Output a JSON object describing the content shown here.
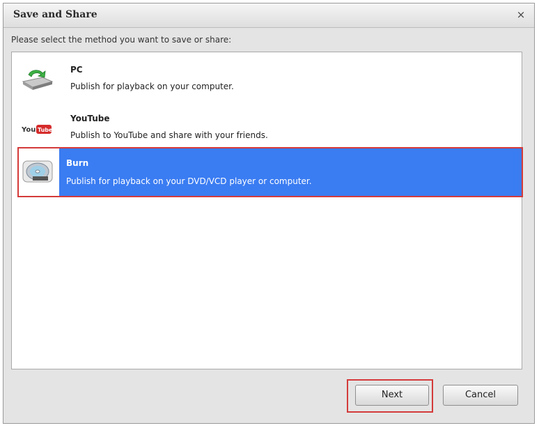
{
  "dialog": {
    "title": "Save and Share",
    "close_symbol": "×",
    "prompt": "Please select the method you want to save or share:"
  },
  "options": [
    {
      "name": "PC",
      "description": "Publish for playback on your computer.",
      "icon": "pc-drive-icon",
      "selected": false
    },
    {
      "name": "YouTube",
      "description": "Publish to YouTube and share with your friends.",
      "icon": "youtube-icon",
      "selected": false
    },
    {
      "name": "Burn",
      "description": "Publish for playback on your DVD/VCD player or computer.",
      "icon": "disc-burn-icon",
      "selected": true
    }
  ],
  "youtube_logo": {
    "you": "You",
    "tube": "Tube"
  },
  "buttons": {
    "next_label": "Next",
    "cancel_label": "Cancel"
  },
  "colors": {
    "selection": "#3a7cf2",
    "focus_outline": "#d43a3a"
  }
}
